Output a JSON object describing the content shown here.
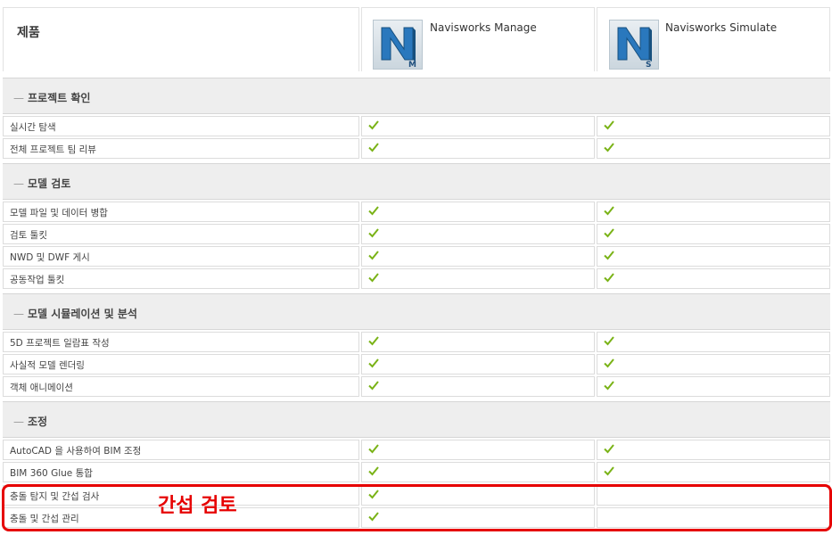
{
  "header": {
    "title": "제품",
    "products": [
      {
        "name": "Navisworks Manage",
        "logo_letter": "N",
        "logo_badge": "M"
      },
      {
        "name": "Navisworks Simulate",
        "logo_letter": "N",
        "logo_badge": "S"
      }
    ]
  },
  "sections": [
    {
      "dash": "—",
      "title": "프로젝트 확인",
      "rows": [
        {
          "feature": "실시간 탐색",
          "manage": true,
          "simulate": true
        },
        {
          "feature": "전체 프로젝트 팀 리뷰",
          "manage": true,
          "simulate": true
        }
      ]
    },
    {
      "dash": "—",
      "title": "모델 검토",
      "rows": [
        {
          "feature": "모델 파일 및 데이터 병합",
          "manage": true,
          "simulate": true
        },
        {
          "feature": "검토 툴킷",
          "manage": true,
          "simulate": true
        },
        {
          "feature": "NWD 및 DWF 게시",
          "manage": true,
          "simulate": true
        },
        {
          "feature": "공동작업 툴킷",
          "manage": true,
          "simulate": true
        }
      ]
    },
    {
      "dash": "—",
      "title": "모델 시뮬레이션 및 분석",
      "rows": [
        {
          "feature": "5D 프로젝트 일람표 작성",
          "manage": true,
          "simulate": true
        },
        {
          "feature": "사실적 모델 렌더링",
          "manage": true,
          "simulate": true
        },
        {
          "feature": "객체 애니메이션",
          "manage": true,
          "simulate": true
        }
      ]
    },
    {
      "dash": "—",
      "title": "조정",
      "rows": [
        {
          "feature": "AutoCAD 을 사용하여 BIM 조정",
          "manage": true,
          "simulate": true
        },
        {
          "feature": "BIM 360 Glue 통합",
          "manage": true,
          "simulate": true
        },
        {
          "feature": "충돌 탐지 및 간섭 검사",
          "manage": true,
          "simulate": false
        },
        {
          "feature": "충돌 및 간섭 관리",
          "manage": true,
          "simulate": false
        }
      ]
    }
  ],
  "annotation": {
    "label": "간섭 검토",
    "color": "#e60000"
  },
  "colors": {
    "check": "#7ab317",
    "section_bg": "#eeeeee",
    "logo_blue": "#1f6fb2"
  },
  "icons": {
    "check": "check-icon",
    "logo": "navisworks-logo-icon"
  }
}
